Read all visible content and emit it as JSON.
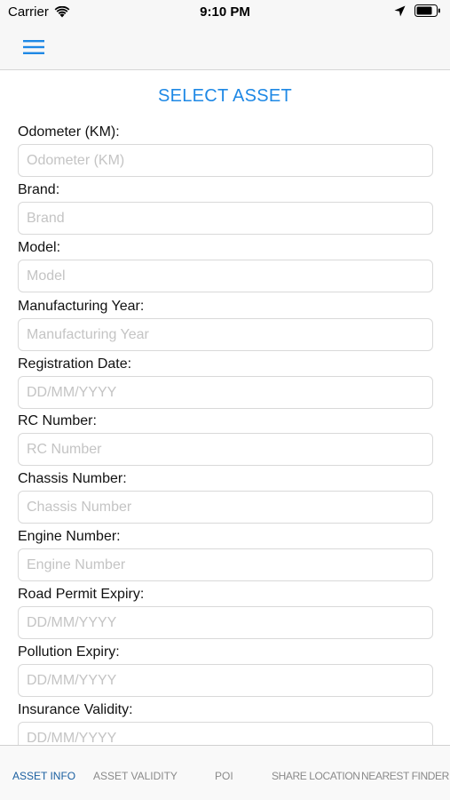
{
  "status_bar": {
    "carrier": "Carrier",
    "time": "9:10 PM",
    "icons": [
      "wifi-icon",
      "location-arrow-icon",
      "battery-icon"
    ]
  },
  "nav": {
    "menu_icon": "hamburger-menu-icon"
  },
  "page": {
    "title": "SELECT ASSET"
  },
  "form": {
    "fields": [
      {
        "label": "Odometer (KM):",
        "placeholder": "Odometer (KM)",
        "value": ""
      },
      {
        "label": "Brand:",
        "placeholder": "Brand",
        "value": ""
      },
      {
        "label": "Model:",
        "placeholder": "Model",
        "value": ""
      },
      {
        "label": "Manufacturing Year:",
        "placeholder": "Manufacturing Year",
        "value": ""
      },
      {
        "label": "Registration Date:",
        "placeholder": "DD/MM/YYYY",
        "value": ""
      },
      {
        "label": "RC Number:",
        "placeholder": "RC Number",
        "value": ""
      },
      {
        "label": "Chassis Number:",
        "placeholder": "Chassis Number",
        "value": ""
      },
      {
        "label": "Engine Number:",
        "placeholder": "Engine Number",
        "value": ""
      },
      {
        "label": "Road Permit Expiry:",
        "placeholder": "DD/MM/YYYY",
        "value": ""
      },
      {
        "label": "Pollution Expiry:",
        "placeholder": "DD/MM/YYYY",
        "value": ""
      },
      {
        "label": "Insurance Validity:",
        "placeholder": "DD/MM/YYYY",
        "value": ""
      }
    ]
  },
  "tabs": [
    {
      "label": "ASSET INFO",
      "active": true
    },
    {
      "label": "ASSET VALIDITY",
      "active": false
    },
    {
      "label": "POI",
      "active": false
    },
    {
      "label": "SHARE LOCATION",
      "active": false
    },
    {
      "label": "NEAREST FINDER",
      "active": false
    }
  ],
  "colors": {
    "accent": "#1e88e5",
    "active_tab": "#1a5fa0",
    "inactive_tab": "#8a8a8a",
    "placeholder": "#c4c4c4"
  }
}
